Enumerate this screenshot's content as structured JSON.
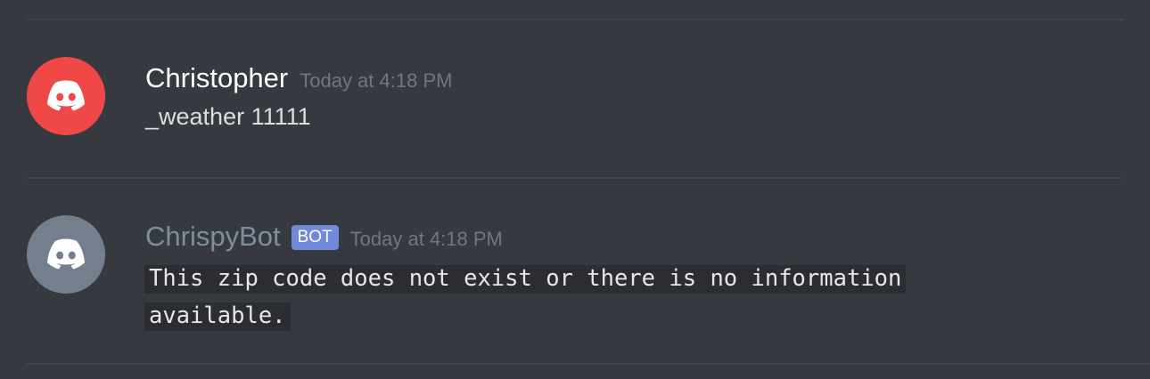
{
  "colors": {
    "background": "#36393f",
    "divider": "#40434a",
    "user_avatar_bg": "#f04747",
    "bot_avatar_bg": "#747f8d",
    "user_name_color": "#ffffff",
    "bot_name_color": "#7e8f9c",
    "bot_tag_bg": "#7289da",
    "timestamp_color": "#72767d",
    "code_bg": "#2b2d33"
  },
  "messages": [
    {
      "author": "Christopher",
      "avatar_icon": "discord-logo-icon",
      "timestamp": "Today at 4:18 PM",
      "text": "_weather 11111"
    },
    {
      "author": "ChrispyBot",
      "avatar_icon": "discord-logo-icon",
      "badge": "BOT",
      "timestamp": "Today at 4:18 PM",
      "code_text": "This zip code does not exist or there is no information available."
    }
  ]
}
